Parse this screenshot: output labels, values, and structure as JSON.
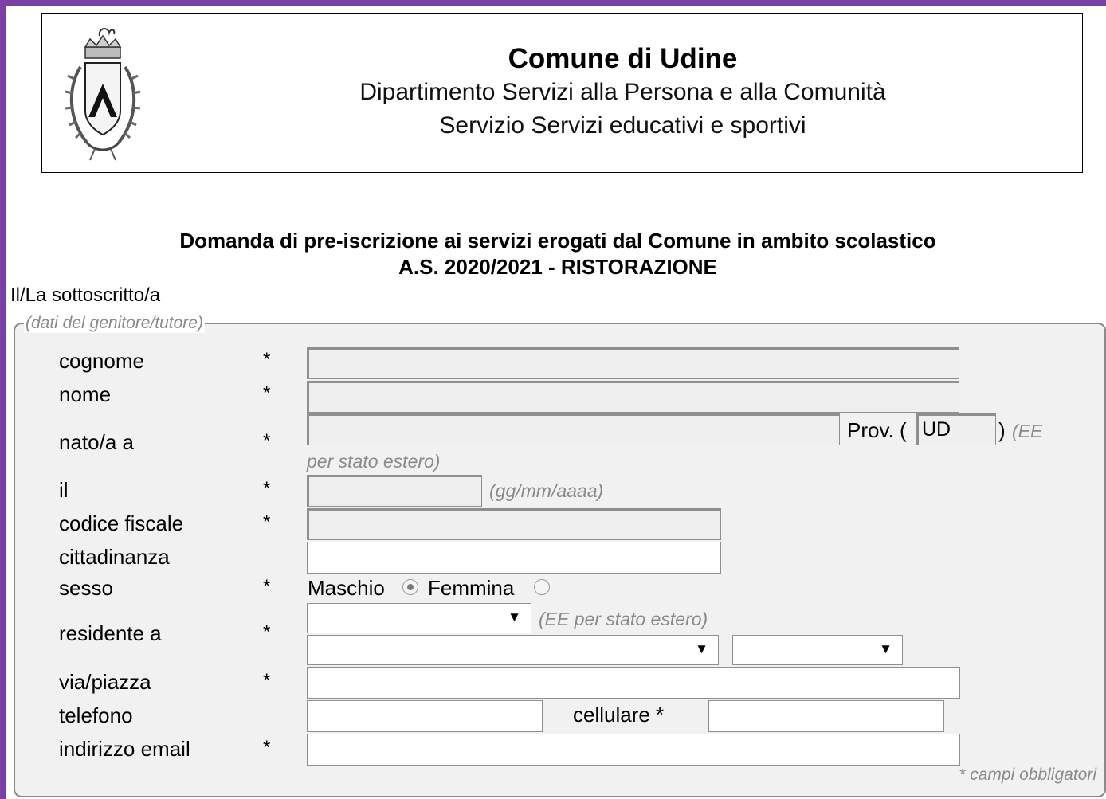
{
  "header": {
    "title": "Comune di Udine",
    "department": "Dipartimento Servizi alla Persona e alla Comunità",
    "service": "Servizio Servizi educativi e sportivi",
    "logo_icon": "coat-of-arms-icon"
  },
  "form": {
    "title_line1": "Domanda di pre-iscrizione ai servizi erogati dal Comune in ambito scolastico",
    "title_line2": "A.S. 2020/2021 - RISTORAZIONE",
    "undersigned": "Il/La sottoscritto/a",
    "legend": "(dati del genitore/tutore)",
    "required_mark": "*",
    "fields": {
      "surname_label": "cognome",
      "name_label": "nome",
      "birthplace_label": "nato/a a",
      "prov_label_open": "Prov. (",
      "prov_value": "UD",
      "prov_label_close": ")",
      "prov_hint_a": "(EE",
      "prov_hint_b": "per stato estero)",
      "birthdate_label": "il",
      "birthdate_hint": "(gg/mm/aaaa)",
      "tax_code_label": "codice fiscale",
      "citizenship_label": "cittadinanza",
      "sex_label": "sesso",
      "male_label": "Maschio",
      "female_label": "Femmina",
      "residence_label": "residente a",
      "residence_hint": "(EE per stato estero)",
      "street_label": "via/piazza",
      "phone_label": "telefono",
      "mobile_label": "cellulare *",
      "email_label": "indirizzo email"
    },
    "required_note": "* campi obbligatori",
    "sex_selected": "Maschio"
  }
}
